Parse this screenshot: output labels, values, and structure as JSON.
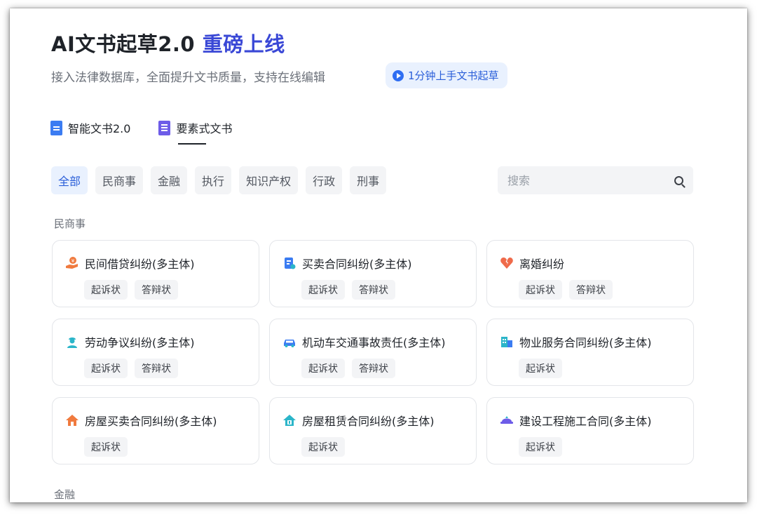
{
  "header": {
    "title_main": "AI文书起草2.0",
    "title_accent": "重磅上线",
    "subtitle": "接入法律数据库，全面提升文书质量，支持在线编辑",
    "quickstart_label": "1分钟上手文书起草"
  },
  "mode_tabs": [
    {
      "label": "智能文书2.0",
      "icon": "doc-icon",
      "active": false
    },
    {
      "label": "要素式文书",
      "icon": "list-icon",
      "active": true
    }
  ],
  "filters": [
    "全部",
    "民商事",
    "金融",
    "执行",
    "知识产权",
    "行政",
    "刑事"
  ],
  "active_filter": "全部",
  "search": {
    "placeholder": "搜索"
  },
  "sections": [
    {
      "label": "民商事",
      "cards": [
        {
          "title": "民间借贷纠纷(多主体)",
          "icon": "loan-hand-icon",
          "icon_color": "#f07a3e",
          "tags": [
            "起诉状",
            "答辩状"
          ]
        },
        {
          "title": "买卖合同纠纷(多主体)",
          "icon": "contract-icon",
          "icon_color": "#3b7cf2",
          "tags": [
            "起诉状",
            "答辩状"
          ]
        },
        {
          "title": "离婚纠纷",
          "icon": "broken-heart-icon",
          "icon_color": "#ef6a4a",
          "tags": [
            "起诉状",
            "答辩状"
          ]
        },
        {
          "title": "劳动争议纠纷(多主体)",
          "icon": "worker-icon",
          "icon_color": "#2bb5c9",
          "tags": [
            "起诉状",
            "答辩状"
          ]
        },
        {
          "title": "机动车交通事故责任(多主体)",
          "icon": "car-icon",
          "icon_color": "#3b7cf2",
          "tags": [
            "起诉状",
            "答辩状"
          ]
        },
        {
          "title": "物业服务合同纠纷(多主体)",
          "icon": "building-icon",
          "icon_color": "#2bb5c9",
          "tags": [
            "起诉状"
          ]
        },
        {
          "title": "房屋买卖合同纠纷(多主体)",
          "icon": "house-icon",
          "icon_color": "#f07a3e",
          "tags": [
            "起诉状"
          ]
        },
        {
          "title": "房屋租赁合同纠纷(多主体)",
          "icon": "house-rent-icon",
          "icon_color": "#2bb5c9",
          "tags": [
            "起诉状"
          ]
        },
        {
          "title": "建设工程施工合同(多主体)",
          "icon": "construction-icon",
          "icon_color": "#6d5ce8",
          "tags": [
            "起诉状"
          ]
        }
      ]
    },
    {
      "label": "金融",
      "cards": []
    }
  ]
}
